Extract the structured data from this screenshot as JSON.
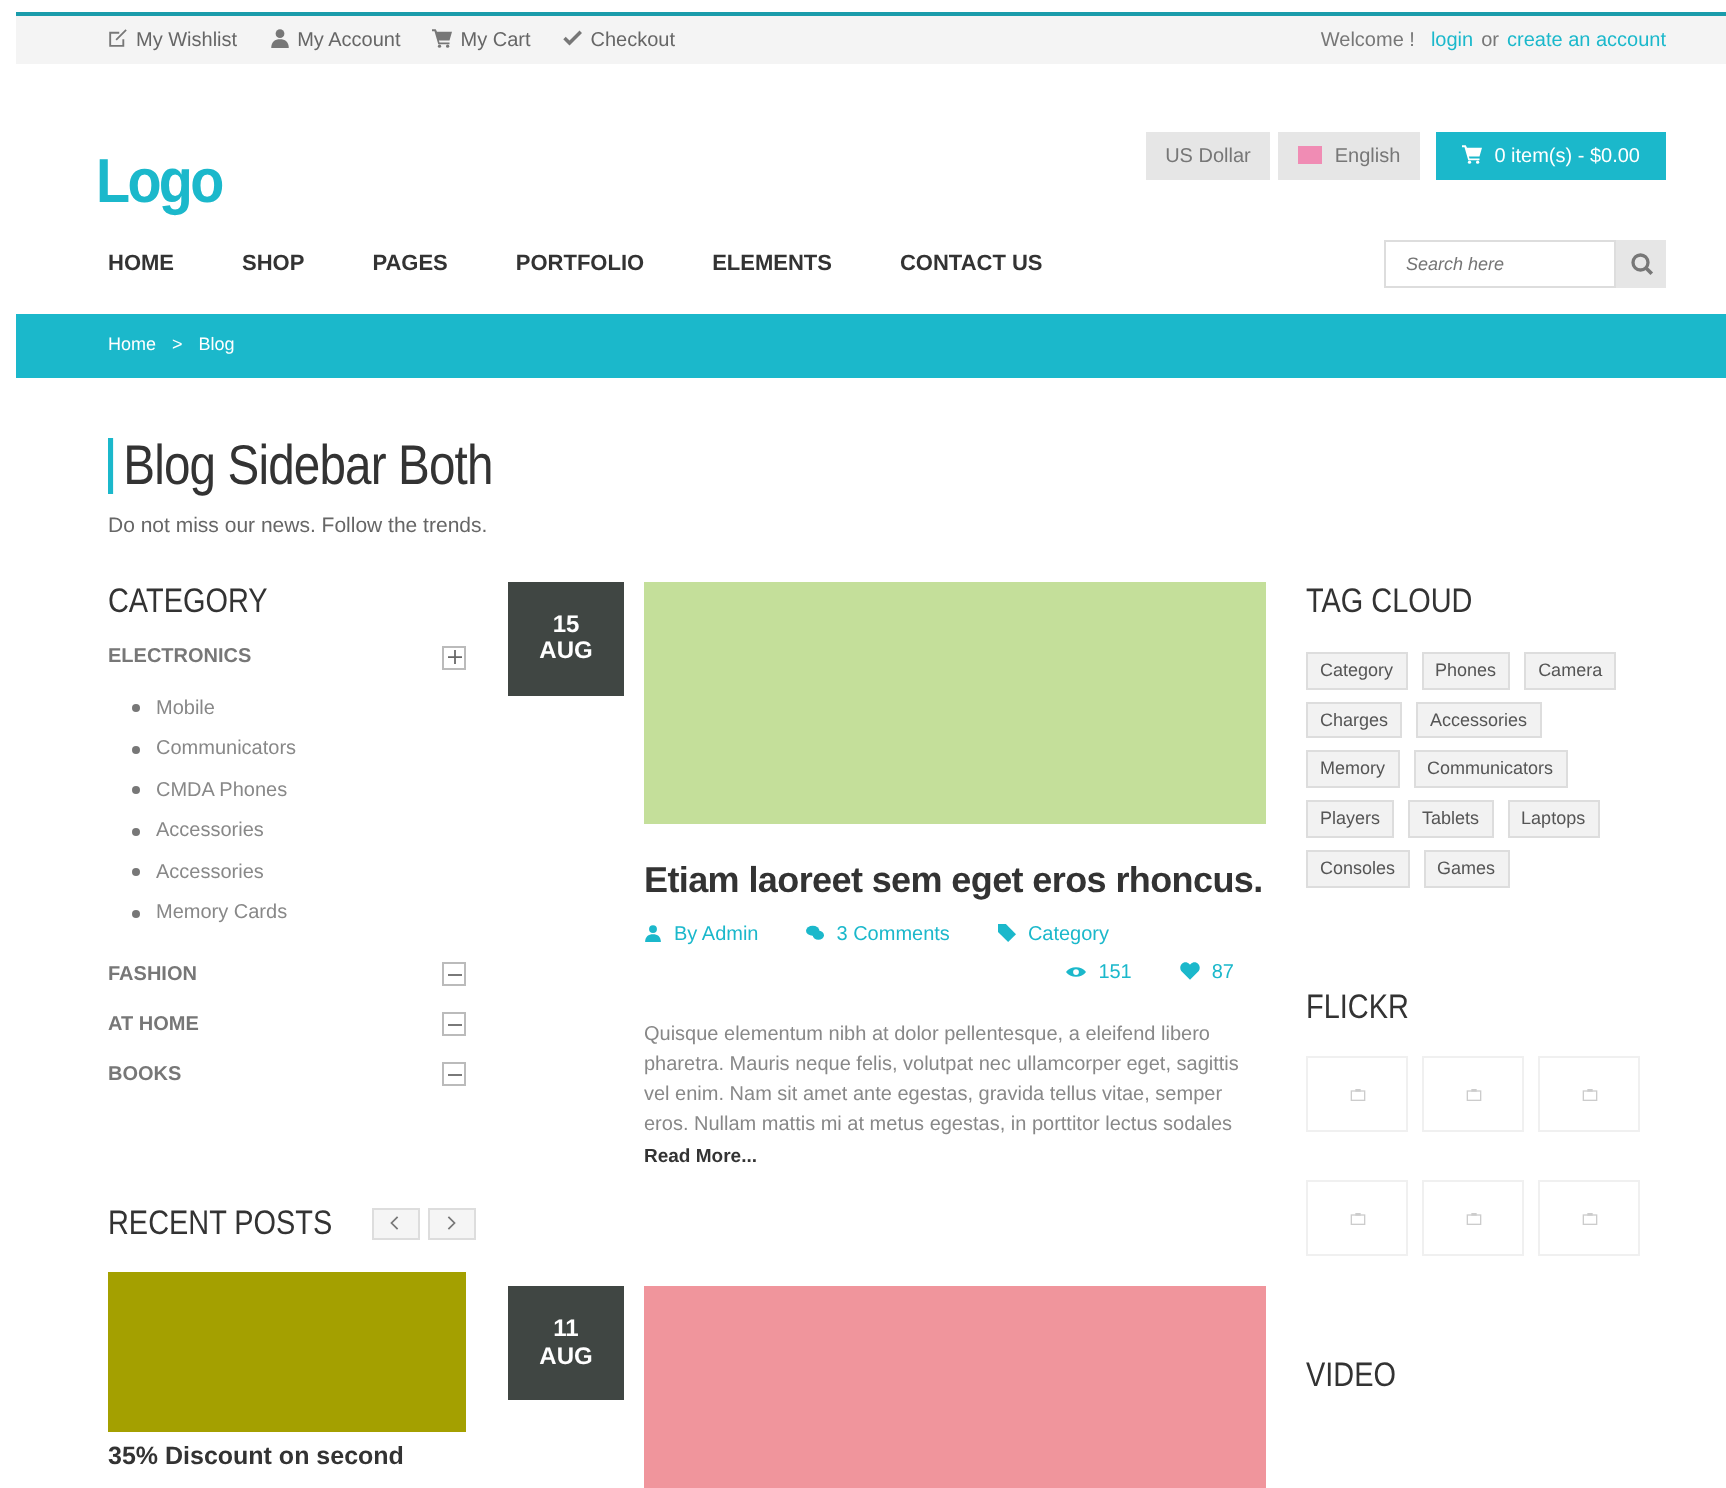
{
  "top_links": [
    {
      "kind": "wishlist",
      "label": "My Wishlist"
    },
    {
      "kind": "account",
      "label": "My Account"
    },
    {
      "kind": "cart",
      "label": "My Cart"
    },
    {
      "kind": "checkout",
      "label": "Checkout"
    }
  ],
  "welcome": {
    "text": "Welcome !",
    "login": "login",
    "or": "or",
    "create": "create an account"
  },
  "logo": "Logo",
  "currency": "US Dollar",
  "language": {
    "label": "English",
    "color": "#f08cb4"
  },
  "cart_button": "0 item(s) - $0.00",
  "nav": [
    "HOME",
    "SHOP",
    "PAGES",
    "PORTFOLIO",
    "ELEMENTS",
    "CONTACT US"
  ],
  "search": {
    "placeholder": "Search here"
  },
  "breadcrumb": [
    "Home",
    "Blog"
  ],
  "breadcrumb_separator": ">",
  "page": {
    "title": "Blog Sidebar Both",
    "subtitle": "Do not miss our news. Follow the trends."
  },
  "category": {
    "title": "CATEGORY",
    "items": [
      {
        "label": "ELECTRONICS",
        "expanded": true,
        "children": [
          "Mobile",
          "Communicators",
          "CMDA Phones",
          "Accessories",
          "Accessories",
          "Memory Cards"
        ]
      },
      {
        "label": "FASHION",
        "expanded": false
      },
      {
        "label": "AT HOME",
        "expanded": false
      },
      {
        "label": "BOOKS",
        "expanded": false
      }
    ]
  },
  "recent_posts": {
    "title": "RECENT POSTS",
    "first_title": "35% Discount on second"
  },
  "posts": [
    {
      "day": "15",
      "month": "AUG",
      "title": "Etiam laoreet sem eget eros rhoncus.",
      "author": "By Admin",
      "comments": "3 Comments",
      "category": "Category",
      "views": "151",
      "likes": "87",
      "excerpt": "Quisque elementum nibh at dolor pellentesque, a eleifend libero pharetra. Mauris neque felis, volutpat nec ullamcorper eget, sagittis vel enim. Nam sit amet ante egestas, gravida tellus vitae, semper eros. Nullam mattis mi at metus egestas, in porttitor lectus sodales",
      "read_more": "Read More..."
    },
    {
      "day": "11",
      "month": "AUG"
    }
  ],
  "tag_cloud": {
    "title": "TAG CLOUD",
    "tags": [
      "Category",
      "Phones",
      "Camera",
      "Charges",
      "Accessories",
      "Memory",
      "Communicators",
      "Players",
      "Tablets",
      "Laptops",
      "Consoles",
      "Games"
    ]
  },
  "flickr": {
    "title": "FLICKR"
  },
  "video": {
    "title": "VIDEO"
  }
}
